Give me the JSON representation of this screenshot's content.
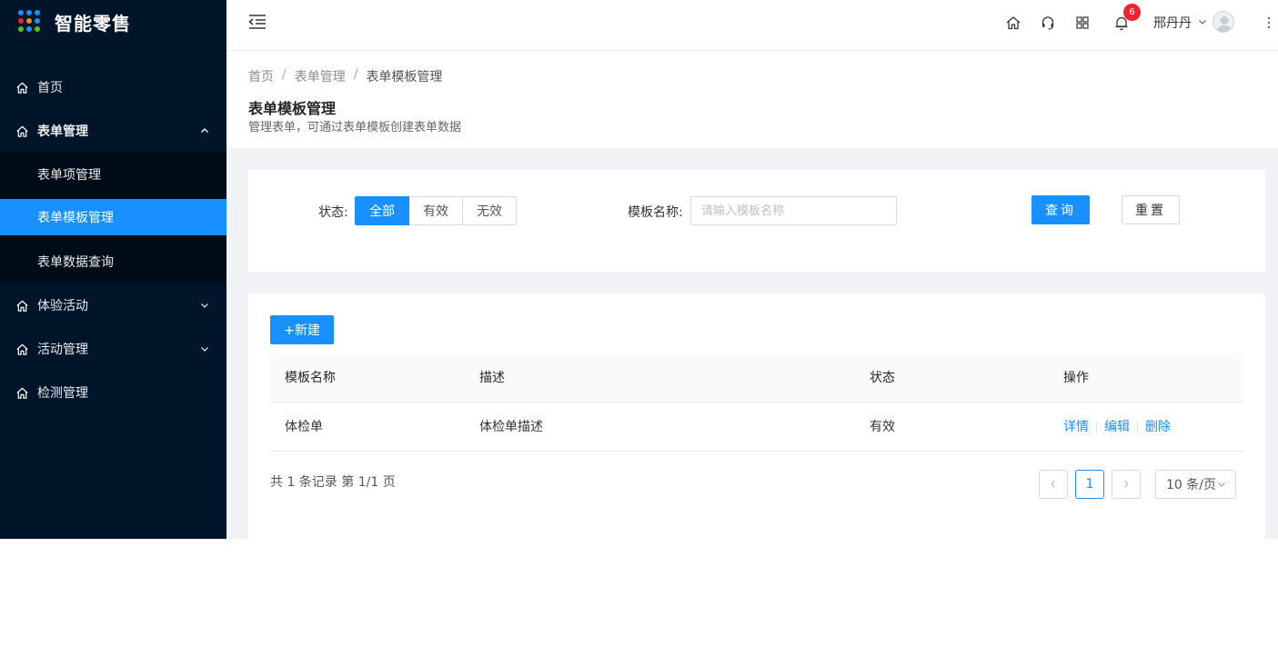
{
  "app": {
    "title": "智能零售"
  },
  "colors": {
    "sidebar": "#001529",
    "submenu": "#000c17",
    "accent": "#1890ff",
    "badge": "#f5222d"
  },
  "sidebar": {
    "items": [
      {
        "label": "首页",
        "icon": "home-icon"
      },
      {
        "label": "表单管理",
        "icon": "home-icon",
        "expanded": true
      },
      {
        "label": "表单项管理"
      },
      {
        "label": "表单模板管理",
        "active": true
      },
      {
        "label": "表单数据查询"
      },
      {
        "label": "体验活动",
        "icon": "home-icon"
      },
      {
        "label": "活动管理",
        "icon": "home-icon"
      },
      {
        "label": "检测管理",
        "icon": "home-icon"
      }
    ]
  },
  "header": {
    "notification_count": "6",
    "user_name": "邢丹丹"
  },
  "breadcrumb": [
    "首页",
    "表单管理",
    "表单模板管理"
  ],
  "page": {
    "title": "表单模板管理",
    "description": "管理表单，可通过表单模板创建表单数据"
  },
  "filter": {
    "status_label": "状态:",
    "status_options": [
      "全部",
      "有效",
      "无效"
    ],
    "status_selected": "全部",
    "name_label": "模板名称:",
    "name_placeholder": "请输入模板名称",
    "name_value": "",
    "query_label": "查询",
    "reset_label": "重置"
  },
  "table": {
    "new_label": "+新建",
    "columns": [
      "模板名称",
      "描述",
      "状态",
      "操作"
    ],
    "rows": [
      {
        "name": "体检单",
        "desc": "体检单描述",
        "status": "有效",
        "actions": [
          "详情",
          "编辑",
          "删除"
        ]
      }
    ]
  },
  "pagination": {
    "summary": "共 1 条记录 第 1/1 页",
    "current_page": "1",
    "page_size": "10 条/页"
  }
}
